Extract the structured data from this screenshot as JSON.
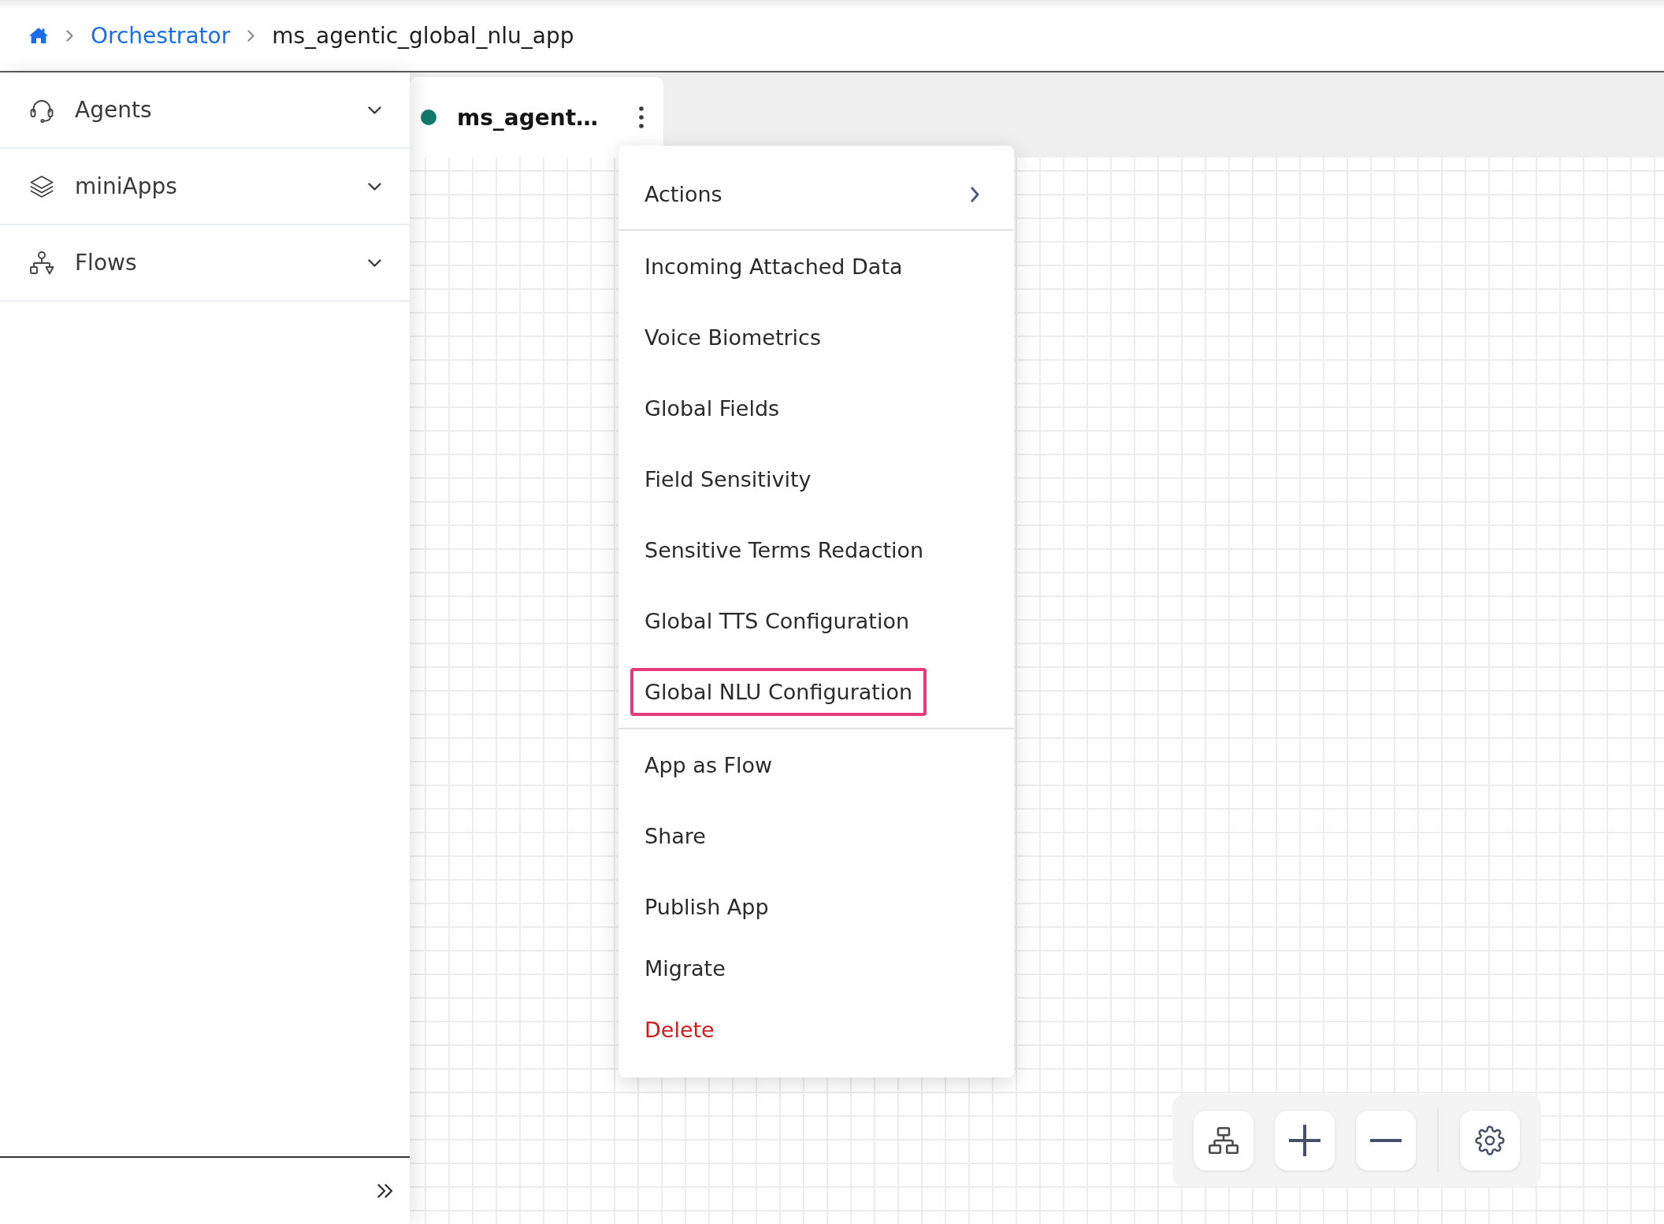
{
  "breadcrumb": [
    {
      "kind": "home"
    },
    {
      "kind": "link",
      "label": "Orchestrator"
    },
    {
      "kind": "current",
      "label": "ms_agentic_global_nlu_app"
    }
  ],
  "sidebar": {
    "items": [
      {
        "label": "Agents",
        "expanded": false
      },
      {
        "label": "miniApps",
        "expanded": false
      },
      {
        "label": "Flows",
        "expanded": false
      }
    ]
  },
  "tabs": [
    {
      "label": "ms_agent…",
      "selected": true,
      "color": "#137a6a"
    }
  ],
  "context_menu": {
    "sections": [
      {
        "items": [
          {
            "label": "Actions",
            "kind": "submenu",
            "highlighted": false
          }
        ]
      },
      {
        "items": [
          {
            "label": "Incoming Attached Data",
            "kind": "action",
            "highlighted": false
          },
          {
            "label": "Voice Biometrics",
            "kind": "action",
            "highlighted": false
          },
          {
            "label": "Global Fields",
            "kind": "action",
            "highlighted": false
          },
          {
            "label": "Field Sensitivity",
            "kind": "action",
            "highlighted": false
          },
          {
            "label": "Sensitive Terms Redaction",
            "kind": "action",
            "highlighted": false
          },
          {
            "label": "Global TTS Configuration",
            "kind": "action",
            "highlighted": false
          },
          {
            "label": "Global NLU Configuration",
            "kind": "action",
            "highlighted": true
          }
        ]
      },
      {
        "items": [
          {
            "label": "App as Flow",
            "kind": "action",
            "highlighted": false
          },
          {
            "label": "Share",
            "kind": "action",
            "highlighted": false
          },
          {
            "label": "Publish App",
            "kind": "action",
            "highlighted": false
          },
          {
            "label": "Migrate",
            "kind": "action",
            "highlighted": false
          },
          {
            "label": "Delete",
            "kind": "danger",
            "highlighted": false
          }
        ]
      }
    ]
  }
}
